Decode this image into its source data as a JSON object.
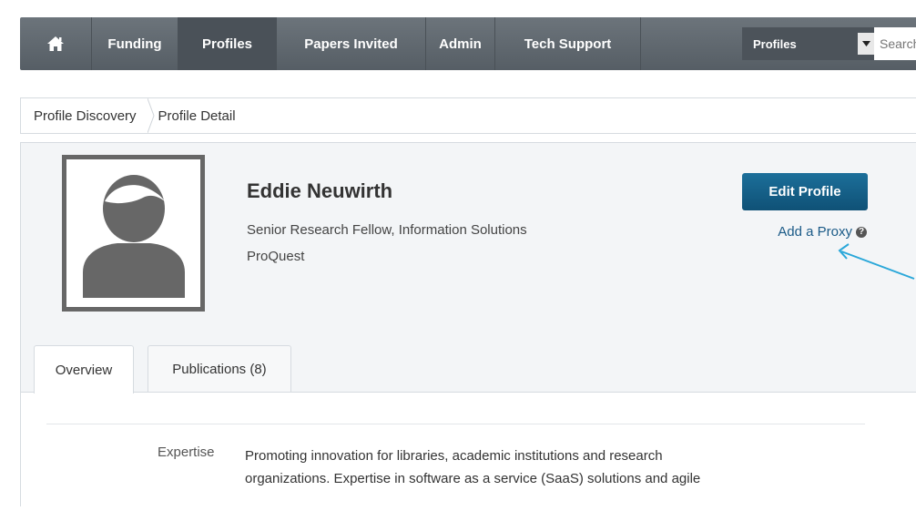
{
  "nav": {
    "items": [
      {
        "label": "Funding",
        "active": false
      },
      {
        "label": "Profiles",
        "active": true
      },
      {
        "label": "Papers Invited",
        "active": false
      },
      {
        "label": "Admin",
        "active": false
      },
      {
        "label": "Tech Support",
        "active": false
      }
    ],
    "search_scope": "Profiles",
    "search_placeholder": "Search"
  },
  "breadcrumb": [
    "Profile Discovery",
    "Profile Detail"
  ],
  "profile": {
    "name": "Eddie Neuwirth",
    "title": "Senior Research Fellow, Information Solutions",
    "organization": "ProQuest",
    "edit_label": "Edit Profile",
    "proxy_label": "Add a Proxy"
  },
  "tabs": [
    "Overview",
    "Publications (8)"
  ],
  "overview": {
    "expertise_label": "Expertise",
    "expertise_line1": "Promoting innovation for libraries, academic institutions and research",
    "expertise_line2": "organizations.  Expertise in software as a service (SaaS) solutions and agile"
  },
  "colors": {
    "nav_bg": "#5f676e",
    "nav_active": "#4a5158",
    "button": "#15607f",
    "link": "#1a5a87",
    "annotation": "#29a7d9"
  }
}
